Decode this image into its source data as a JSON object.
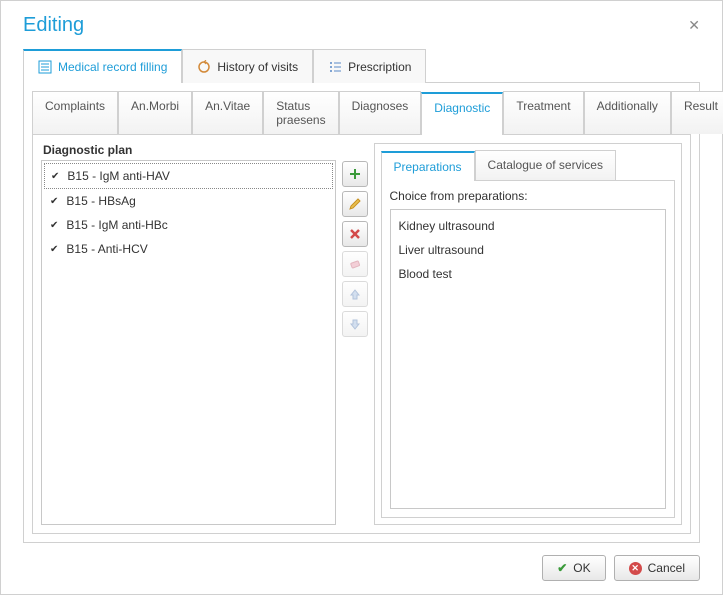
{
  "window": {
    "title": "Editing"
  },
  "outer_tabs": [
    {
      "label": "Medical record filling"
    },
    {
      "label": "History of visits"
    },
    {
      "label": "Prescription"
    }
  ],
  "inner_tabs": [
    {
      "label": "Complaints"
    },
    {
      "label": "An.Morbi"
    },
    {
      "label": "An.Vitae"
    },
    {
      "label": "Status praesens"
    },
    {
      "label": "Diagnoses"
    },
    {
      "label": "Diagnostic"
    },
    {
      "label": "Treatment"
    },
    {
      "label": "Additionally"
    },
    {
      "label": "Result"
    }
  ],
  "diagnostic": {
    "section_title": "Diagnostic plan",
    "items": [
      {
        "label": "B15 - IgM anti-HAV"
      },
      {
        "label": "B15 - HBsAg"
      },
      {
        "label": "B15 - IgM anti-HBc"
      },
      {
        "label": "B15 - Anti-HCV"
      }
    ]
  },
  "sub_tabs": [
    {
      "label": "Preparations"
    },
    {
      "label": "Catalogue of services"
    }
  ],
  "preparations": {
    "choice_label": "Choice from preparations:",
    "items": [
      {
        "label": "Kidney ultrasound"
      },
      {
        "label": "Liver ultrasound"
      },
      {
        "label": "Blood test"
      }
    ]
  },
  "footer": {
    "ok": "OK",
    "cancel": "Cancel"
  }
}
